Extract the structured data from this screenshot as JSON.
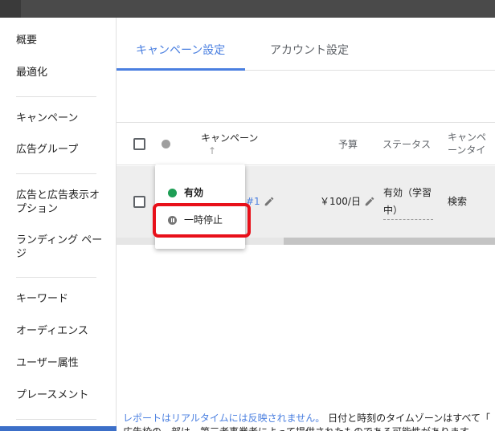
{
  "sidebar": {
    "items": [
      {
        "label": "概要"
      },
      {
        "label": "最適化"
      },
      {
        "label": "キャンペーン"
      },
      {
        "label": "広告グループ"
      },
      {
        "label": "広告と広告表示オプション"
      },
      {
        "label": "ランディング ページ"
      },
      {
        "label": "キーワード"
      },
      {
        "label": "オーディエンス"
      },
      {
        "label": "ユーザー属性"
      },
      {
        "label": "プレースメント"
      }
    ]
  },
  "tabs": [
    {
      "label": "キャンペーン設定"
    },
    {
      "label": "アカウント設定"
    }
  ],
  "table": {
    "headers": {
      "campaign": "キャンペーン",
      "sort_arrow": "↑",
      "budget": "予算",
      "status": "ステータス",
      "type": "キャンペーンタイプ"
    },
    "row": {
      "campaign_suffix": "#1",
      "budget": "￥100/日",
      "status": "有効（学習中）",
      "type": "検索"
    }
  },
  "status_menu": {
    "enabled": "有効",
    "paused": "一時停止"
  },
  "footer": {
    "link": "レポートはリアルタイムには反映されません。",
    "note": "日付と時刻のタイムゾーンはすべて「",
    "line2": "広告枠の一部は、第三者事業者によって提供されたものである可能性があります。"
  },
  "colors": {
    "accent": "#4a7fe0",
    "enabled_dot": "#1e9e55",
    "highlight": "#e8101a"
  }
}
